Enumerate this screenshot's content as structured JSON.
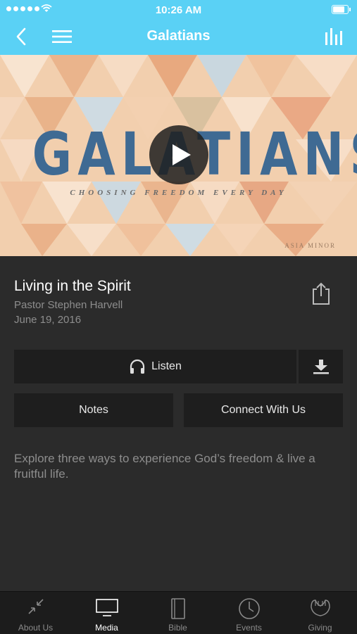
{
  "status_bar": {
    "time": "10:26 AM"
  },
  "nav": {
    "title": "Galatians"
  },
  "hero": {
    "word": "GALATIANS",
    "tagline": "CHOOSING FREEDOM EVERY DAY",
    "corner_text": "ASIA MINOR"
  },
  "sermon": {
    "title": "Living in the Spirit",
    "speaker": "Pastor Stephen Harvell",
    "date": "June 19, 2016"
  },
  "actions": {
    "listen_label": "Listen",
    "notes_label": "Notes",
    "connect_label": "Connect With Us"
  },
  "description": "Explore three ways to experience God’s freedom & live a fruitful life.",
  "tabs": [
    {
      "label": "About Us",
      "icon": "compress-arrows-icon",
      "active": false
    },
    {
      "label": "Media",
      "icon": "tv-icon",
      "active": true
    },
    {
      "label": "Bible",
      "icon": "book-icon",
      "active": false
    },
    {
      "label": "Events",
      "icon": "clock-icon",
      "active": false
    },
    {
      "label": "Giving",
      "icon": "praying-hands-icon",
      "active": false
    }
  ],
  "colors": {
    "accent": "#5ad1f5",
    "background": "#2b2b2b",
    "button": "#1e1e1e",
    "hero_text": "#3f6a93"
  }
}
